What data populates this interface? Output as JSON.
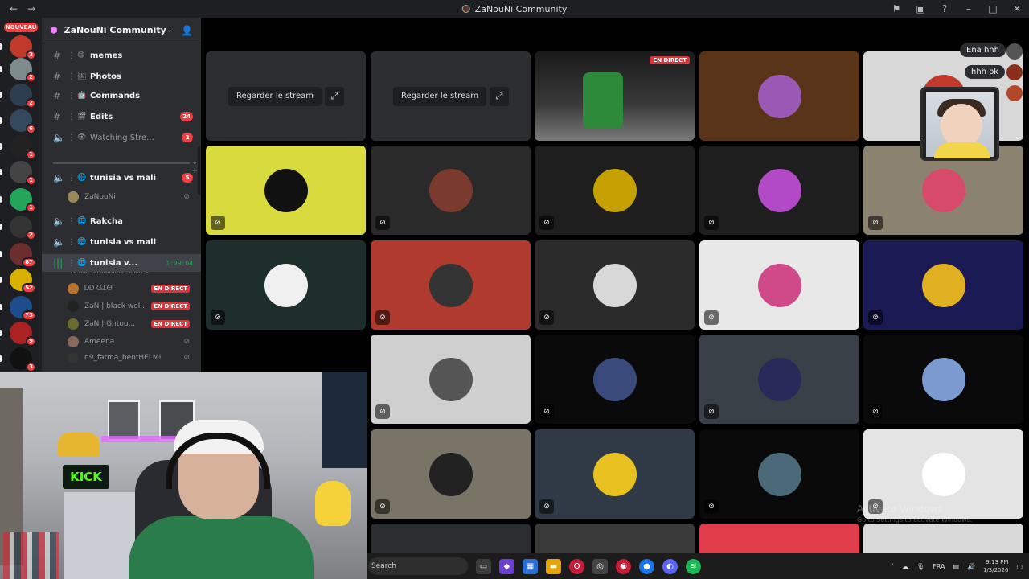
{
  "window": {
    "title": "ZaNouNi Community",
    "nav_back": "←",
    "nav_forward": "→"
  },
  "rail": {
    "new_label": "NOUVEAU",
    "servers": [
      {
        "badge": "2",
        "color": "#c0392b"
      },
      {
        "badge": "2",
        "color": "#7f8c8d"
      },
      {
        "badge": "2",
        "color": "#2c3e50"
      },
      {
        "badge": "6",
        "color": "#34495e"
      },
      {
        "badge": "1",
        "color": "#222222"
      },
      {
        "badge": "1",
        "color": "#444444"
      },
      {
        "badge": "1",
        "color": "#23a55a"
      },
      {
        "badge": "2",
        "color": "#333333"
      },
      {
        "badge": "87",
        "color": "#6b2d2d"
      },
      {
        "badge": "52",
        "color": "#d9b000"
      },
      {
        "badge": "73",
        "color": "#1e4d8c"
      },
      {
        "badge": "9",
        "color": "#aa2222"
      },
      {
        "badge": "3",
        "color": "#111111"
      },
      {
        "badge": "",
        "color": "#53fc18"
      }
    ]
  },
  "sidebar": {
    "guild_name": "ZaNouNi Community",
    "channels": [
      {
        "kind": "text",
        "name": "memes",
        "emoji": "😄",
        "bold": true,
        "badge": ""
      },
      {
        "kind": "text",
        "name": "Photos",
        "emoji": "🖼",
        "bold": true,
        "badge": ""
      },
      {
        "kind": "text",
        "name": "Commands",
        "emoji": "🤖",
        "bold": true,
        "badge": ""
      },
      {
        "kind": "text",
        "name": "Edits",
        "emoji": "🎬",
        "bold": true,
        "badge": "24"
      },
      {
        "kind": "voice",
        "name": "Watching Stre...",
        "emoji": "👁",
        "bold": false,
        "badge": "2"
      }
    ],
    "voice_channels": [
      {
        "name": "tunisia vs mali",
        "badge": "5"
      },
      {
        "name": "Rakcha",
        "badge": ""
      },
      {
        "name": "tunisia vs mali",
        "badge": ""
      },
      {
        "name": "tunisia v...",
        "timer": "1:09:04"
      }
    ],
    "voice_user_top": "ZaNouNi",
    "status_hint": "Définir un statut de salon",
    "users": [
      {
        "name": "ᎠᎠ ᏀᏆᎾ",
        "live": "EN DIRECT"
      },
      {
        "name": "ZaN | black wol...",
        "live": "EN DIRECT"
      },
      {
        "name": "ZaN | Ghtou...",
        "live": "EN DIRECT"
      },
      {
        "name": "Ameena",
        "live": ""
      },
      {
        "name": "n9_fatma_bentHELMI",
        "live": ""
      }
    ]
  },
  "grid": {
    "watch_stream": "Regarder le stream",
    "live_badge": "EN DIRECT",
    "bubbles": [
      "Ena hhh",
      "hhh ok"
    ],
    "tile_colors": [
      "#2b2d31",
      "#2b2d31",
      "#3a3a3a",
      "#5a3418",
      "#d8d8d8",
      "#d8da3e",
      "#2a2a2a",
      "#1e1e1e",
      "#1e1e1e",
      "#8b8270",
      "#1e2e2a",
      "#b03a2e",
      "#2b2b2b",
      "#e8e8e8",
      "#1a1a55",
      "#c9ced6",
      "#cfcfcf",
      "#0a0a0a",
      "#3a4048",
      "#0a0a0a",
      "#000000",
      "#7a7466",
      "#2f3a46",
      "#0a0a0a",
      "#e4e4e4"
    ]
  },
  "windows_notice": {
    "title": "Activate Windows",
    "subtitle": "Go to Settings to activate Windows."
  },
  "taskbar": {
    "search": "Search",
    "lang": "FRA",
    "time": "9:13 PM",
    "date": "1/3/2026"
  }
}
